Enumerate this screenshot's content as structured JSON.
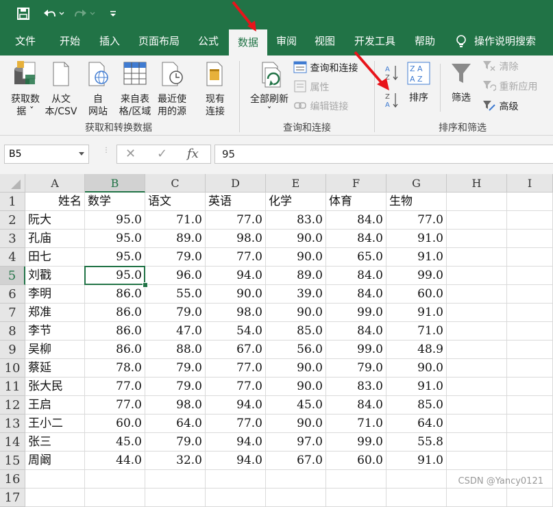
{
  "tabs": [
    "文件",
    "开始",
    "插入",
    "页面布局",
    "公式",
    "数据",
    "审阅",
    "视图",
    "开发工具",
    "帮助",
    "操作说明搜索"
  ],
  "active_tab": "数据",
  "ribbon": {
    "get_data": [
      "获取数",
      "据 ˇ"
    ],
    "from_csv": [
      "从文",
      "本/CSV"
    ],
    "from_web": [
      "自",
      "网站"
    ],
    "from_table": [
      "来自表",
      "格/区域"
    ],
    "recent_sources": [
      "最近使",
      "用的源"
    ],
    "existing_conn": [
      "现有",
      "连接"
    ],
    "group1": "获取和转换数据",
    "refresh_all": [
      "全部刷新",
      "ˇ"
    ],
    "queries_conn": "查询和连接",
    "properties": "属性",
    "edit_links": "编辑链接",
    "group2": "查询和连接",
    "sort": "排序",
    "filter": "筛选",
    "clear": "清除",
    "reapply": "重新应用",
    "advanced": "高级",
    "group3": "排序和筛选"
  },
  "formula": {
    "name_box": "B5",
    "cancel": "✕",
    "enter": "✓",
    "fx": "fx",
    "value": "95"
  },
  "columns": [
    "A",
    "B",
    "C",
    "D",
    "E",
    "F",
    "G",
    "H",
    "I"
  ],
  "rows": [
    "1",
    "2",
    "3",
    "4",
    "5",
    "6",
    "7",
    "8",
    "9",
    "10",
    "11",
    "12",
    "13",
    "14",
    "15",
    "16",
    "17"
  ],
  "header_row": [
    "姓名",
    "数学",
    "语文",
    "英语",
    "化学",
    "体育",
    "生物"
  ],
  "data": [
    [
      "阮大",
      "95.0",
      "71.0",
      "77.0",
      "83.0",
      "84.0",
      "77.0"
    ],
    [
      "孔庙",
      "95.0",
      "89.0",
      "98.0",
      "90.0",
      "84.0",
      "91.0"
    ],
    [
      "田七",
      "95.0",
      "79.0",
      "77.0",
      "90.0",
      "65.0",
      "91.0"
    ],
    [
      "刘戳",
      "95.0",
      "96.0",
      "94.0",
      "89.0",
      "84.0",
      "99.0"
    ],
    [
      "李明",
      "86.0",
      "55.0",
      "90.0",
      "39.0",
      "84.0",
      "60.0"
    ],
    [
      "郑准",
      "86.0",
      "79.0",
      "98.0",
      "90.0",
      "99.0",
      "91.0"
    ],
    [
      "李节",
      "86.0",
      "47.0",
      "54.0",
      "85.0",
      "84.0",
      "71.0"
    ],
    [
      "吴柳",
      "86.0",
      "88.0",
      "67.0",
      "56.0",
      "99.0",
      "48.9"
    ],
    [
      "蔡延",
      "78.0",
      "79.0",
      "77.0",
      "90.0",
      "79.0",
      "90.0"
    ],
    [
      "张大民",
      "77.0",
      "79.0",
      "77.0",
      "90.0",
      "83.0",
      "91.0"
    ],
    [
      "王启",
      "77.0",
      "98.0",
      "94.0",
      "45.0",
      "84.0",
      "85.0"
    ],
    [
      "王小二",
      "60.0",
      "64.0",
      "77.0",
      "90.0",
      "71.0",
      "64.0"
    ],
    [
      "张三",
      "45.0",
      "79.0",
      "94.0",
      "97.0",
      "99.0",
      "55.8"
    ],
    [
      "周阚",
      "44.0",
      "32.0",
      "94.0",
      "67.0",
      "60.0",
      "91.0"
    ]
  ],
  "watermark": "CSDN @Yancy0121",
  "colors": {
    "excel_green": "#217346",
    "arrow_red": "#e8141b"
  }
}
